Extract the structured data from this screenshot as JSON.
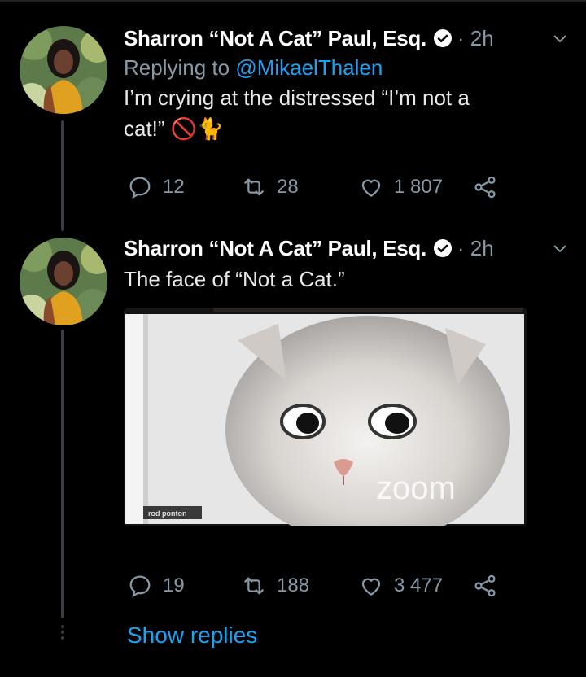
{
  "tweets": [
    {
      "author": "Sharron “Not A Cat” Paul, Esq.",
      "time": "· 2h",
      "replying_prefix": "Replying to ",
      "replying_handle": "@MikaelThalen",
      "text_line1": "I’m crying at the distressed “I’m not a",
      "text_line2": "cat!”",
      "emoji_no": "🚫",
      "emoji_cat": "🐈",
      "replies": "12",
      "retweets": "28",
      "likes": "1 807"
    },
    {
      "author": "Sharron “Not A Cat” Paul, Esq.",
      "time": "· 2h",
      "text": "The face of “Not a Cat.”",
      "media_watermark": "zoom",
      "media_nameplate": "rod ponton",
      "replies": "19",
      "retweets": "188",
      "likes": "3 477"
    }
  ],
  "show_replies": "Show replies",
  "colors": {
    "background": "#000000",
    "muted": "#8899a6",
    "accent": "#1da1f2",
    "thread_line": "#3a3d42"
  }
}
